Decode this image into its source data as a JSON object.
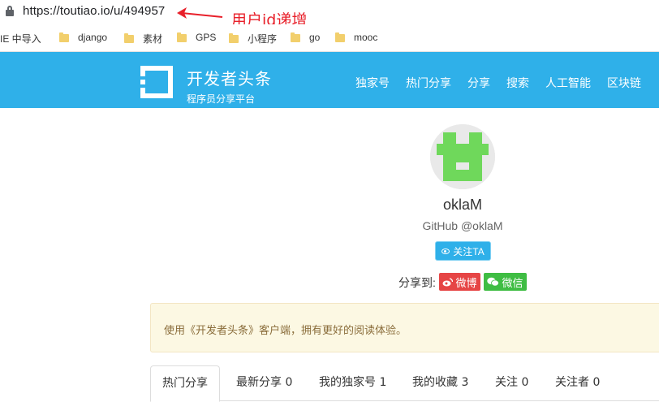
{
  "browser": {
    "url_base": "https://toutiao.io",
    "url_path": "/u/494957",
    "annotation": "用户id递增"
  },
  "bookmarks": [
    {
      "label": "IE 中导入",
      "icon": "none"
    },
    {
      "label": "django",
      "icon": "folder-icon"
    },
    {
      "label": "素材",
      "icon": "folder-icon"
    },
    {
      "label": "GPS",
      "icon": "folder-icon"
    },
    {
      "label": "小程序",
      "icon": "folder-icon"
    },
    {
      "label": "go",
      "icon": "folder-icon"
    },
    {
      "label": "mooc",
      "icon": "folder-icon"
    }
  ],
  "header": {
    "site_name": "开发者头条",
    "slogan": "程序员分享平台",
    "nav": [
      "独家号",
      "热门分享",
      "分享",
      "搜索",
      "人工智能",
      "区块链"
    ],
    "accent_color": "#2fb0e9"
  },
  "profile": {
    "username": "oklaM",
    "github": "GitHub @oklaM",
    "follow_label": "关注TA",
    "share_label": "分享到:",
    "share_weibo": "微博",
    "share_wechat": "微信"
  },
  "notice": {
    "text": "使用《开发者头条》客户端，拥有更好的阅读体验。"
  },
  "tabs": [
    {
      "label": "热门分享",
      "active": true
    },
    {
      "label": "最新分享 0",
      "active": false
    },
    {
      "label": "我的独家号 1",
      "active": false
    },
    {
      "label": "我的收藏 3",
      "active": false
    },
    {
      "label": "关注 0",
      "active": false
    },
    {
      "label": "关注者 0",
      "active": false
    }
  ]
}
